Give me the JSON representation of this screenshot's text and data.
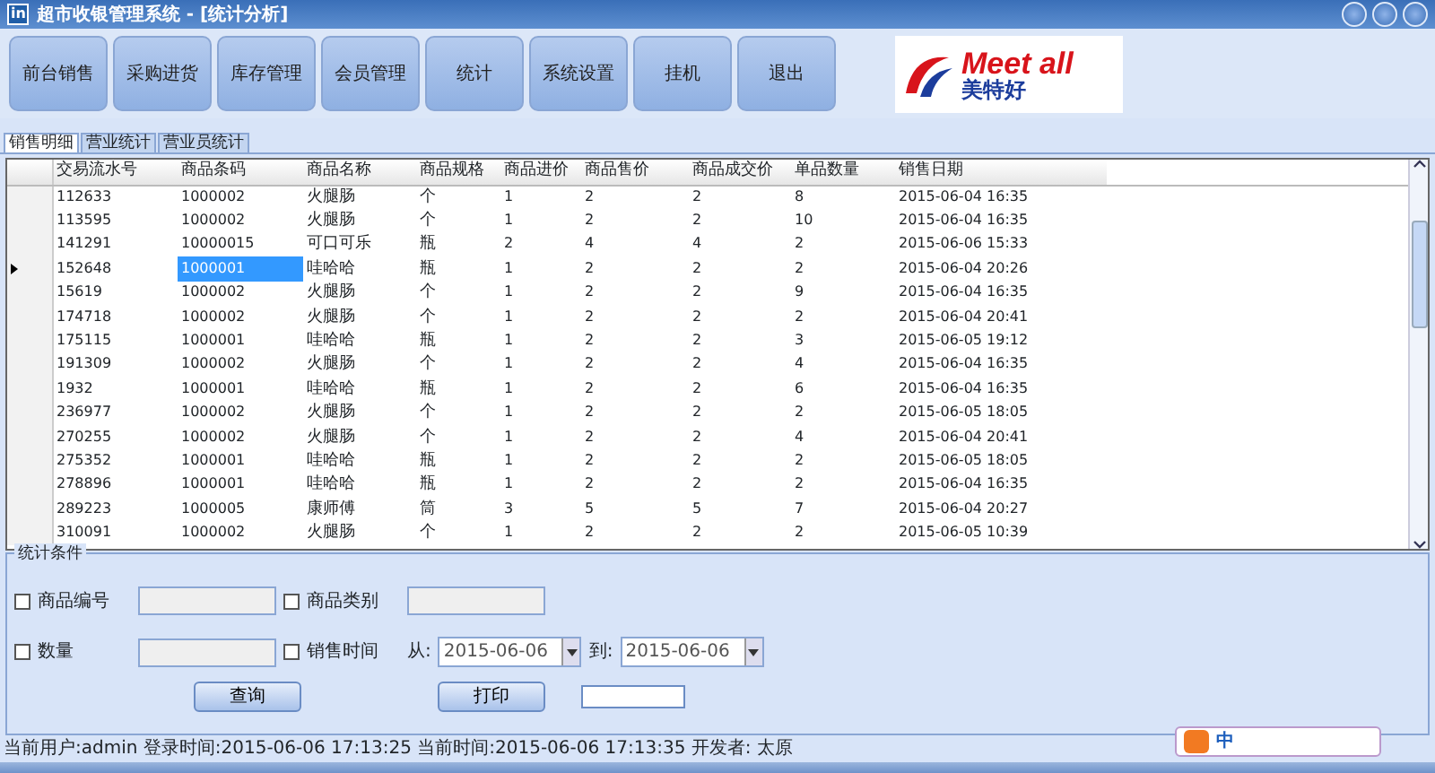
{
  "window": {
    "icon_text": "in",
    "title": "超市收银管理系统 - [统计分析]"
  },
  "toolbar": [
    {
      "label": "前台销售"
    },
    {
      "label": "采购进货"
    },
    {
      "label": "库存管理"
    },
    {
      "label": "会员管理"
    },
    {
      "label": "统计"
    },
    {
      "label": "系统设置"
    },
    {
      "label": "挂机"
    },
    {
      "label": "退出"
    }
  ],
  "logo": {
    "text": "Meet all",
    "subtext": "美特好"
  },
  "tabs": [
    {
      "label": "销售明细",
      "selected": true
    },
    {
      "label": "营业统计",
      "selected": false
    },
    {
      "label": "营业员统计",
      "selected": false
    }
  ],
  "grid": {
    "columns": [
      {
        "label": "交易流水号",
        "focused": false
      },
      {
        "label": "商品条码",
        "focused": true
      },
      {
        "label": "商品名称",
        "focused": false
      },
      {
        "label": "商品规格",
        "focused": false
      },
      {
        "label": "商品进价",
        "focused": false
      },
      {
        "label": "商品售价",
        "focused": false
      },
      {
        "label": "商品成交价",
        "focused": false
      },
      {
        "label": "单品数量",
        "focused": false
      },
      {
        "label": "销售日期",
        "focused": false
      }
    ],
    "rows": [
      {
        "current": false,
        "cells": [
          "112633",
          "1000002",
          "火腿肠",
          "个",
          "1",
          "2",
          "2",
          "8",
          "2015-06-04 16:35"
        ]
      },
      {
        "current": false,
        "cells": [
          "113595",
          "1000002",
          "火腿肠",
          "个",
          "1",
          "2",
          "2",
          "10",
          "2015-06-04 16:35"
        ]
      },
      {
        "current": false,
        "cells": [
          "141291",
          "10000015",
          "可口可乐",
          "瓶",
          "2",
          "4",
          "4",
          "2",
          "2015-06-06 15:33"
        ]
      },
      {
        "current": true,
        "cells": [
          "152648",
          "1000001",
          "哇哈哈",
          "瓶",
          "1",
          "2",
          "2",
          "2",
          "2015-06-04 20:26"
        ]
      },
      {
        "current": false,
        "cells": [
          "15619",
          "1000002",
          "火腿肠",
          "个",
          "1",
          "2",
          "2",
          "9",
          "2015-06-04 16:35"
        ]
      },
      {
        "current": false,
        "cells": [
          "174718",
          "1000002",
          "火腿肠",
          "个",
          "1",
          "2",
          "2",
          "2",
          "2015-06-04 20:41"
        ]
      },
      {
        "current": false,
        "cells": [
          "175115",
          "1000001",
          "哇哈哈",
          "瓶",
          "1",
          "2",
          "2",
          "3",
          "2015-06-05 19:12"
        ]
      },
      {
        "current": false,
        "cells": [
          "191309",
          "1000002",
          "火腿肠",
          "个",
          "1",
          "2",
          "2",
          "4",
          "2015-06-04 16:35"
        ]
      },
      {
        "current": false,
        "cells": [
          "1932",
          "1000001",
          "哇哈哈",
          "瓶",
          "1",
          "2",
          "2",
          "6",
          "2015-06-04 16:35"
        ]
      },
      {
        "current": false,
        "cells": [
          "236977",
          "1000002",
          "火腿肠",
          "个",
          "1",
          "2",
          "2",
          "2",
          "2015-06-05 18:05"
        ]
      },
      {
        "current": false,
        "cells": [
          "270255",
          "1000002",
          "火腿肠",
          "个",
          "1",
          "2",
          "2",
          "4",
          "2015-06-04 20:41"
        ]
      },
      {
        "current": false,
        "cells": [
          "275352",
          "1000001",
          "哇哈哈",
          "瓶",
          "1",
          "2",
          "2",
          "2",
          "2015-06-05 18:05"
        ]
      },
      {
        "current": false,
        "cells": [
          "278896",
          "1000001",
          "哇哈哈",
          "瓶",
          "1",
          "2",
          "2",
          "2",
          "2015-06-04 16:35"
        ]
      },
      {
        "current": false,
        "cells": [
          "289223",
          "1000005",
          "康师傅",
          "筒",
          "3",
          "5",
          "5",
          "7",
          "2015-06-04 20:27"
        ]
      },
      {
        "current": false,
        "cells": [
          "310091",
          "1000002",
          "火腿肠",
          "个",
          "1",
          "2",
          "2",
          "2",
          "2015-06-05 10:39"
        ]
      }
    ]
  },
  "filter_panel": {
    "title": "统计条件",
    "filters": [
      {
        "kind": "field",
        "label": "商品编号",
        "checked": false
      },
      {
        "kind": "field",
        "label": "商品类别",
        "checked": false
      },
      {
        "kind": "field",
        "label": "数量",
        "checked": false
      },
      {
        "kind": "date_range",
        "label": "销售时间",
        "checked": false,
        "from_label": "从:",
        "from": "2015-06-06",
        "to_label": "到:",
        "to": "2015-06-06"
      }
    ],
    "buttons": [
      {
        "label": "查询"
      },
      {
        "label": "打印"
      }
    ]
  },
  "status_bar": "当前用户:admin 登录时间:2015-06-06 17:13:25 当前时间:2015-06-06 17:13:35 开发者: 太原",
  "ime": {
    "label": "中"
  }
}
